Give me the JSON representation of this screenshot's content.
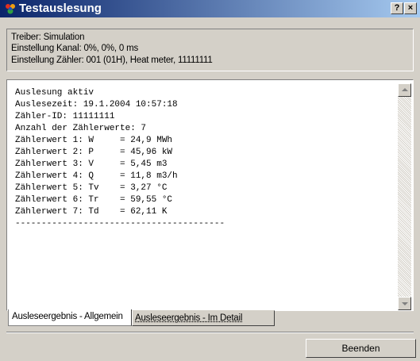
{
  "window": {
    "title": "Testauslesung",
    "help_glyph": "?",
    "close_glyph": "×"
  },
  "info": {
    "driver": "Treiber: Simulation",
    "channel": "Einstellung Kanal: 0%, 0%, 0 ms",
    "meter": "Einstellung Zähler: 001 (01H), Heat meter, 11111111"
  },
  "log": {
    "lines": [
      "Auslesung aktiv",
      "Auslesezeit: 19.1.2004 10:57:18",
      "Zähler-ID: 11111111",
      "Anzahl der Zählerwerte: 7",
      "Zählerwert 1: W     = 24,9 MWh",
      "Zählerwert 2: P     = 45,96 kW",
      "Zählerwert 3: V     = 5,45 m3",
      "Zählerwert 4: Q     = 11,8 m3/h",
      "Zählerwert 5: Tv    = 3,27 °C",
      "Zählerwert 6: Tr    = 59,55 °C",
      "Zählerwert 7: Td    = 62,11 K",
      "----------------------------------------"
    ]
  },
  "tabs": [
    {
      "label": "Ausleseergebnis - Allgemein"
    },
    {
      "label": "Ausleseergebnis - Im Detail"
    }
  ],
  "buttons": {
    "close_label": "Beenden"
  },
  "colors": {
    "titlebar_start": "#0a246a",
    "titlebar_end": "#a6caf0",
    "face": "#d4d0c8"
  }
}
